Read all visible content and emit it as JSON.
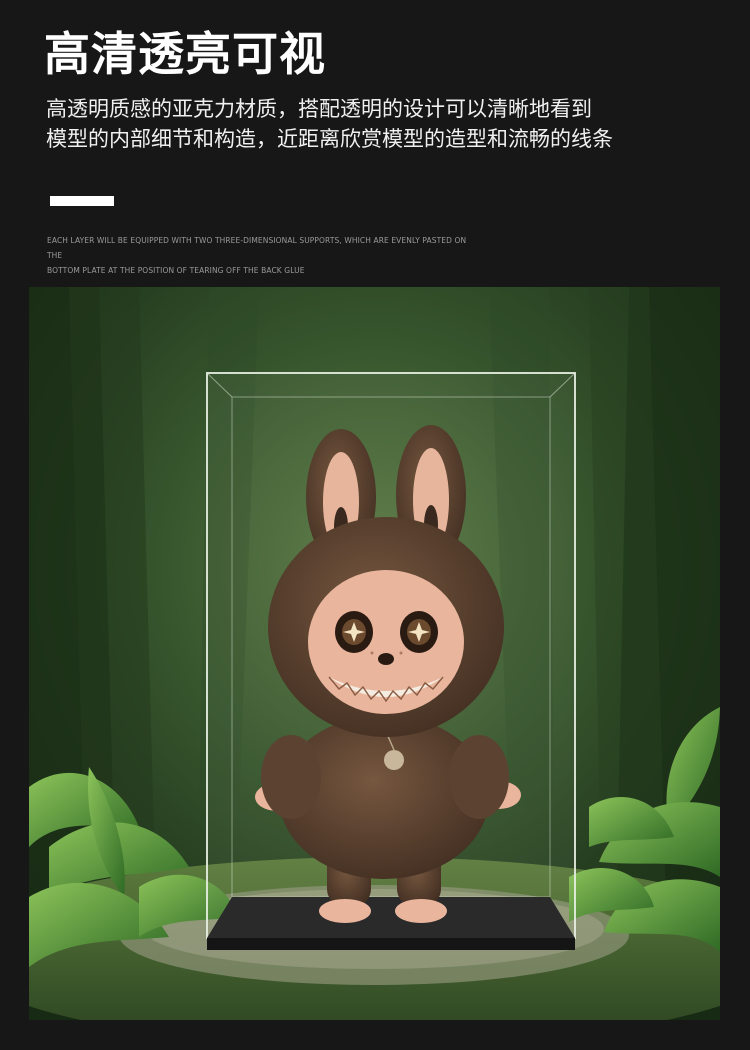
{
  "title": "高清透亮可视",
  "description": {
    "line1": "高透明质感的亚克力材质，搭配透明的设计可以清晰地看到",
    "line2": "模型的内部细节和构造，近距离欣赏模型的造型和流畅的线条"
  },
  "caption": {
    "line1": "EACH LAYER WILL BE EQUIPPED WITH TWO THREE-DIMENSIONAL SUPPORTS, WHICH ARE EVENLY PASTED ON THE",
    "line2": "BOTTOM PLATE AT THE POSITION OF TEARING OFF THE BACK GLUE"
  },
  "colors": {
    "background": "#171717",
    "accent_bar": "#ffffff",
    "forest": "#2f4d27",
    "fur": "#5a4030"
  }
}
